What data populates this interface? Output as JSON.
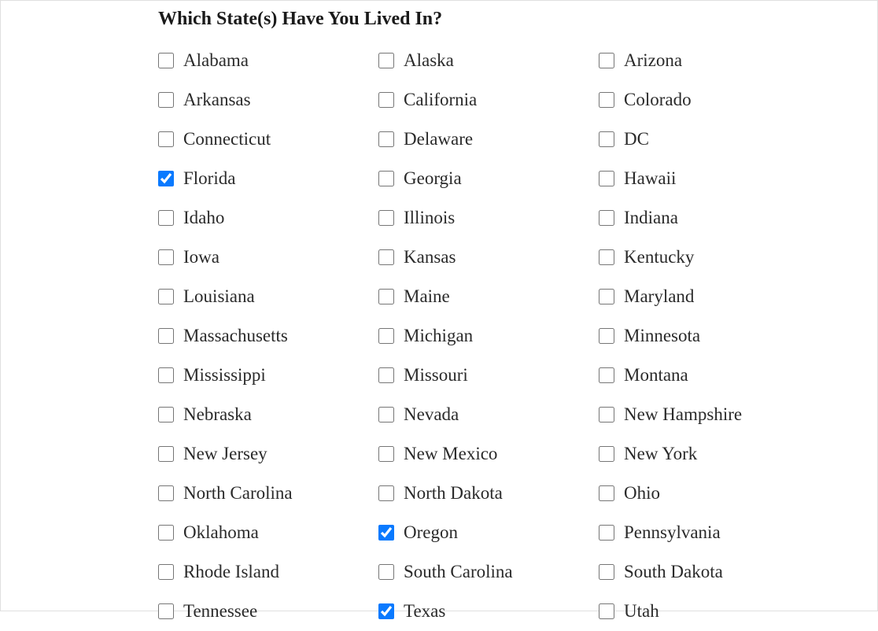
{
  "title": "Which State(s) Have You Lived In?",
  "states": [
    {
      "label": "Alabama",
      "checked": false
    },
    {
      "label": "Alaska",
      "checked": false
    },
    {
      "label": "Arizona",
      "checked": false
    },
    {
      "label": "Arkansas",
      "checked": false
    },
    {
      "label": "California",
      "checked": false
    },
    {
      "label": "Colorado",
      "checked": false
    },
    {
      "label": "Connecticut",
      "checked": false
    },
    {
      "label": "Delaware",
      "checked": false
    },
    {
      "label": "DC",
      "checked": false
    },
    {
      "label": "Florida",
      "checked": true
    },
    {
      "label": "Georgia",
      "checked": false
    },
    {
      "label": "Hawaii",
      "checked": false
    },
    {
      "label": "Idaho",
      "checked": false
    },
    {
      "label": "Illinois",
      "checked": false
    },
    {
      "label": "Indiana",
      "checked": false
    },
    {
      "label": "Iowa",
      "checked": false
    },
    {
      "label": "Kansas",
      "checked": false
    },
    {
      "label": "Kentucky",
      "checked": false
    },
    {
      "label": "Louisiana",
      "checked": false
    },
    {
      "label": "Maine",
      "checked": false
    },
    {
      "label": "Maryland",
      "checked": false
    },
    {
      "label": "Massachusetts",
      "checked": false
    },
    {
      "label": "Michigan",
      "checked": false
    },
    {
      "label": "Minnesota",
      "checked": false
    },
    {
      "label": "Mississippi",
      "checked": false
    },
    {
      "label": "Missouri",
      "checked": false
    },
    {
      "label": "Montana",
      "checked": false
    },
    {
      "label": "Nebraska",
      "checked": false
    },
    {
      "label": "Nevada",
      "checked": false
    },
    {
      "label": "New Hampshire",
      "checked": false
    },
    {
      "label": "New Jersey",
      "checked": false
    },
    {
      "label": "New Mexico",
      "checked": false
    },
    {
      "label": "New York",
      "checked": false
    },
    {
      "label": "North Carolina",
      "checked": false
    },
    {
      "label": "North Dakota",
      "checked": false
    },
    {
      "label": "Ohio",
      "checked": false
    },
    {
      "label": "Oklahoma",
      "checked": false
    },
    {
      "label": "Oregon",
      "checked": true
    },
    {
      "label": "Pennsylvania",
      "checked": false
    },
    {
      "label": "Rhode Island",
      "checked": false
    },
    {
      "label": "South Carolina",
      "checked": false
    },
    {
      "label": "South Dakota",
      "checked": false
    },
    {
      "label": "Tennessee",
      "checked": false
    },
    {
      "label": "Texas",
      "checked": true
    },
    {
      "label": "Utah",
      "checked": false
    }
  ]
}
